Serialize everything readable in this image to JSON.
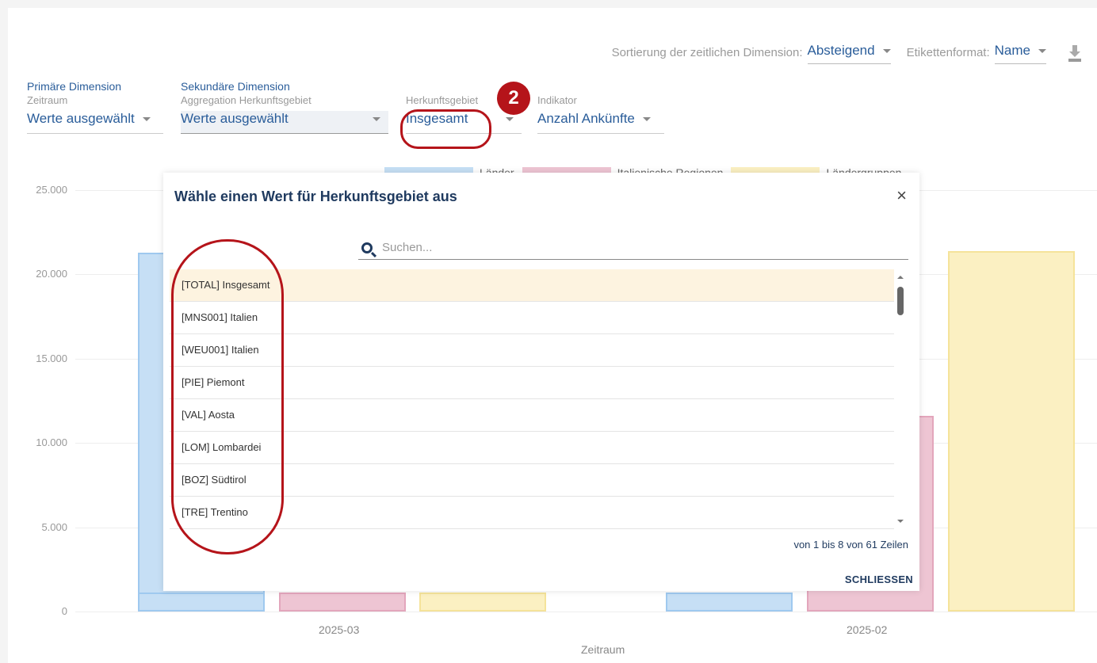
{
  "toolbar": {
    "sort_label": "Sortierung der zeitlichen Dimension:",
    "sort_value": "Absteigend",
    "label_format_label": "Etikettenformat:",
    "label_format_value": "Name"
  },
  "filters": {
    "primary": {
      "title": "Primäre Dimension",
      "subtitle": "Zeitraum",
      "value": "Werte ausgewählt"
    },
    "secondary": {
      "title": "Sekundäre Dimension",
      "subtitle": "Aggregation Herkunftsgebiet",
      "value": "Werte ausgewählt"
    },
    "origin": {
      "subtitle": "Herkunftsgebiet",
      "value": "Insgesamt"
    },
    "indicator": {
      "subtitle": "Indikator",
      "value": "Anzahl Ankünfte"
    }
  },
  "annotation": {
    "badge": "2"
  },
  "modal": {
    "title": "Wähle einen Wert für Herkunftsgebiet aus",
    "close_icon": "close-icon",
    "search_placeholder": "Suchen...",
    "items": [
      "[TOTAL] Insgesamt",
      "[MNS001] Italien",
      "[WEU001] Italien",
      "[PIE] Piemont",
      "[VAL] Aosta",
      "[LOM] Lombardei",
      "[BOZ] Südtirol",
      "[TRE] Trentino"
    ],
    "selected_index": 0,
    "pager_text": "von 1 bis 8 von 61 Zeilen",
    "close_label": "SCHLIESSEN"
  },
  "chart_data": {
    "type": "bar",
    "categories": [
      "2025-03",
      "2025-02"
    ],
    "series": [
      {
        "name": "Länder",
        "color": "#c6dff5",
        "values": [
          21300,
          null
        ]
      },
      {
        "name": "Italienische Regionen",
        "color": "#eec5d3",
        "values": [
          null,
          11600
        ]
      },
      {
        "name": "Ländergruppen",
        "color": "#fbf0c2",
        "values": [
          null,
          21400
        ]
      }
    ],
    "xlabel": "Zeitraum",
    "yticks": [
      "25.000",
      "20.000",
      "15.000",
      "10.000",
      "5.000",
      "0"
    ],
    "ylim": [
      0,
      25000
    ]
  }
}
